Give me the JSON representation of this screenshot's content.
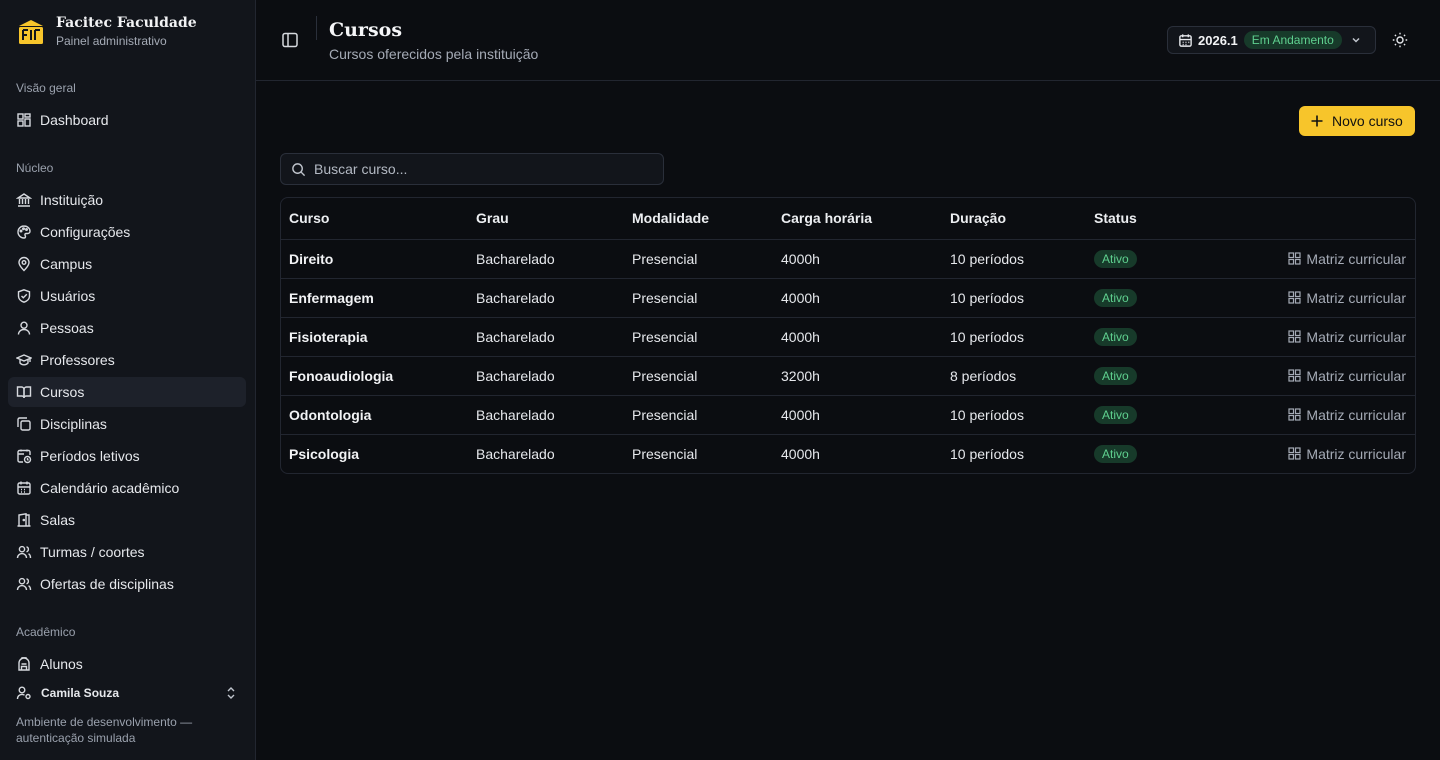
{
  "brand": {
    "name": "Facitec Faculdade",
    "subtitle": "Painel administrativo",
    "accent": "#f7c52b"
  },
  "sidebar": {
    "sections": [
      {
        "title": "Visão geral",
        "items": [
          {
            "label": "Dashboard",
            "icon": "dashboard-icon"
          }
        ]
      },
      {
        "title": "Núcleo",
        "items": [
          {
            "label": "Instituição",
            "icon": "building-icon"
          },
          {
            "label": "Configurações",
            "icon": "palette-icon"
          },
          {
            "label": "Campus",
            "icon": "map-pin-icon"
          },
          {
            "label": "Usuários",
            "icon": "shield-icon"
          },
          {
            "label": "Pessoas",
            "icon": "user-icon"
          },
          {
            "label": "Professores",
            "icon": "graduation-cap-icon"
          },
          {
            "label": "Cursos",
            "icon": "book-open-icon",
            "active": true
          },
          {
            "label": "Disciplinas",
            "icon": "copy-icon"
          },
          {
            "label": "Períodos letivos",
            "icon": "calendar-clock-icon"
          },
          {
            "label": "Calendário acadêmico",
            "icon": "calendar-icon"
          },
          {
            "label": "Salas",
            "icon": "door-icon"
          },
          {
            "label": "Turmas / coortes",
            "icon": "users-icon"
          },
          {
            "label": "Ofertas de disciplinas",
            "icon": "users-icon"
          }
        ]
      },
      {
        "title": "Acadêmico",
        "items": [
          {
            "label": "Alunos",
            "icon": "backpack-icon"
          }
        ]
      }
    ],
    "user": {
      "name": "Camila Souza"
    },
    "env_note": "Ambiente de desenvolvimento — autenticação simulada"
  },
  "header": {
    "title": "Cursos",
    "subtitle": "Cursos oferecidos pela instituição",
    "period": {
      "year": "2026.1",
      "status": "Em Andamento"
    }
  },
  "actions": {
    "new_course": "Novo curso"
  },
  "search": {
    "placeholder": "Buscar curso...",
    "value": ""
  },
  "table": {
    "columns": [
      "Curso",
      "Grau",
      "Modalidade",
      "Carga horária",
      "Duração",
      "Status"
    ],
    "action_label": "Matriz curricular",
    "rows": [
      {
        "curso": "Direito",
        "grau": "Bacharelado",
        "modalidade": "Presencial",
        "carga": "4000h",
        "duracao": "10 períodos",
        "status": "Ativo"
      },
      {
        "curso": "Enfermagem",
        "grau": "Bacharelado",
        "modalidade": "Presencial",
        "carga": "4000h",
        "duracao": "10 períodos",
        "status": "Ativo"
      },
      {
        "curso": "Fisioterapia",
        "grau": "Bacharelado",
        "modalidade": "Presencial",
        "carga": "4000h",
        "duracao": "10 períodos",
        "status": "Ativo"
      },
      {
        "curso": "Fonoaudiologia",
        "grau": "Bacharelado",
        "modalidade": "Presencial",
        "carga": "3200h",
        "duracao": "8 períodos",
        "status": "Ativo"
      },
      {
        "curso": "Odontologia",
        "grau": "Bacharelado",
        "modalidade": "Presencial",
        "carga": "4000h",
        "duracao": "10 períodos",
        "status": "Ativo"
      },
      {
        "curso": "Psicologia",
        "grau": "Bacharelado",
        "modalidade": "Presencial",
        "carga": "4000h",
        "duracao": "10 períodos",
        "status": "Ativo"
      }
    ]
  }
}
